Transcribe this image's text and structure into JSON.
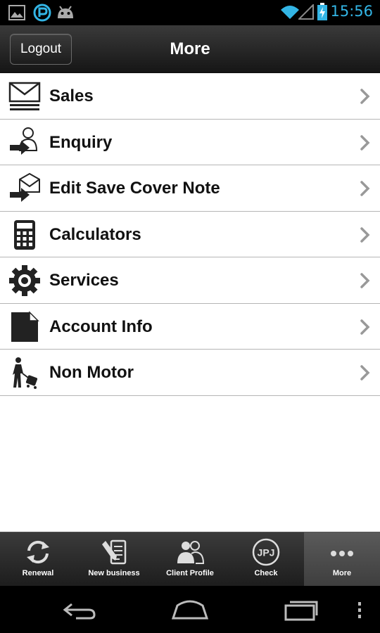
{
  "status_bar": {
    "time": "15:56",
    "left_icons": [
      "image-icon",
      "sync-app-icon",
      "android-icon"
    ],
    "right_icons": [
      "wifi-icon",
      "signal-icon",
      "battery-charging-icon"
    ],
    "accent_color": "#33b5e5"
  },
  "header": {
    "logout_label": "Logout",
    "title": "More"
  },
  "menu": {
    "items": [
      {
        "label": "Sales",
        "icon": "envelope-icon"
      },
      {
        "label": "Enquiry",
        "icon": "person-arrow-icon"
      },
      {
        "label": "Edit Save Cover Note",
        "icon": "mail-arrow-icon"
      },
      {
        "label": "Calculators",
        "icon": "calculator-icon"
      },
      {
        "label": "Services",
        "icon": "gear-icon"
      },
      {
        "label": "Account Info",
        "icon": "document-icon"
      },
      {
        "label": "Non Motor",
        "icon": "traveler-luggage-icon"
      }
    ]
  },
  "tabs": {
    "items": [
      {
        "label": "Renewal",
        "icon": "refresh-icon"
      },
      {
        "label": "New business",
        "icon": "pen-document-icon"
      },
      {
        "label": "Client Profile",
        "icon": "users-icon"
      },
      {
        "label": "Check",
        "icon": "jpj-badge-icon",
        "badge_text": "JPJ"
      },
      {
        "label": "More",
        "icon": "more-dots-icon"
      }
    ],
    "active": "More"
  },
  "nav_bar": {
    "icons": [
      "back-icon",
      "home-icon",
      "recent-apps-icon",
      "overflow-menu-icon"
    ]
  }
}
